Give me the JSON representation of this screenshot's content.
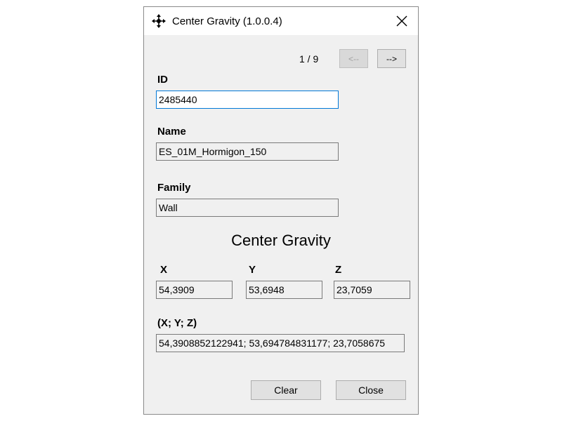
{
  "window": {
    "title": "Center Gravity (1.0.0.4)",
    "icon": "move-cross-icon"
  },
  "navigation": {
    "counter": "1 / 9",
    "prev_label": "<--",
    "next_label": "-->"
  },
  "fields": {
    "id": {
      "label": "ID",
      "value": "2485440"
    },
    "name": {
      "label": "Name",
      "value": "ES_01M_Hormigon_150"
    },
    "family": {
      "label": "Family",
      "value": "Wall"
    }
  },
  "center_gravity": {
    "title": "Center Gravity",
    "x": {
      "label": "X",
      "value": "54,3909"
    },
    "y": {
      "label": "Y",
      "value": "53,6948"
    },
    "z": {
      "label": "Z",
      "value": "23,7059"
    },
    "xyz": {
      "label": "(X; Y; Z)",
      "value": "54,3908852122941; 53,694784831177; 23,7058675"
    }
  },
  "buttons": {
    "clear": "Clear",
    "close": "Close"
  },
  "colors": {
    "focus_border": "#0078d7",
    "window_bg": "#f0f0f0"
  }
}
